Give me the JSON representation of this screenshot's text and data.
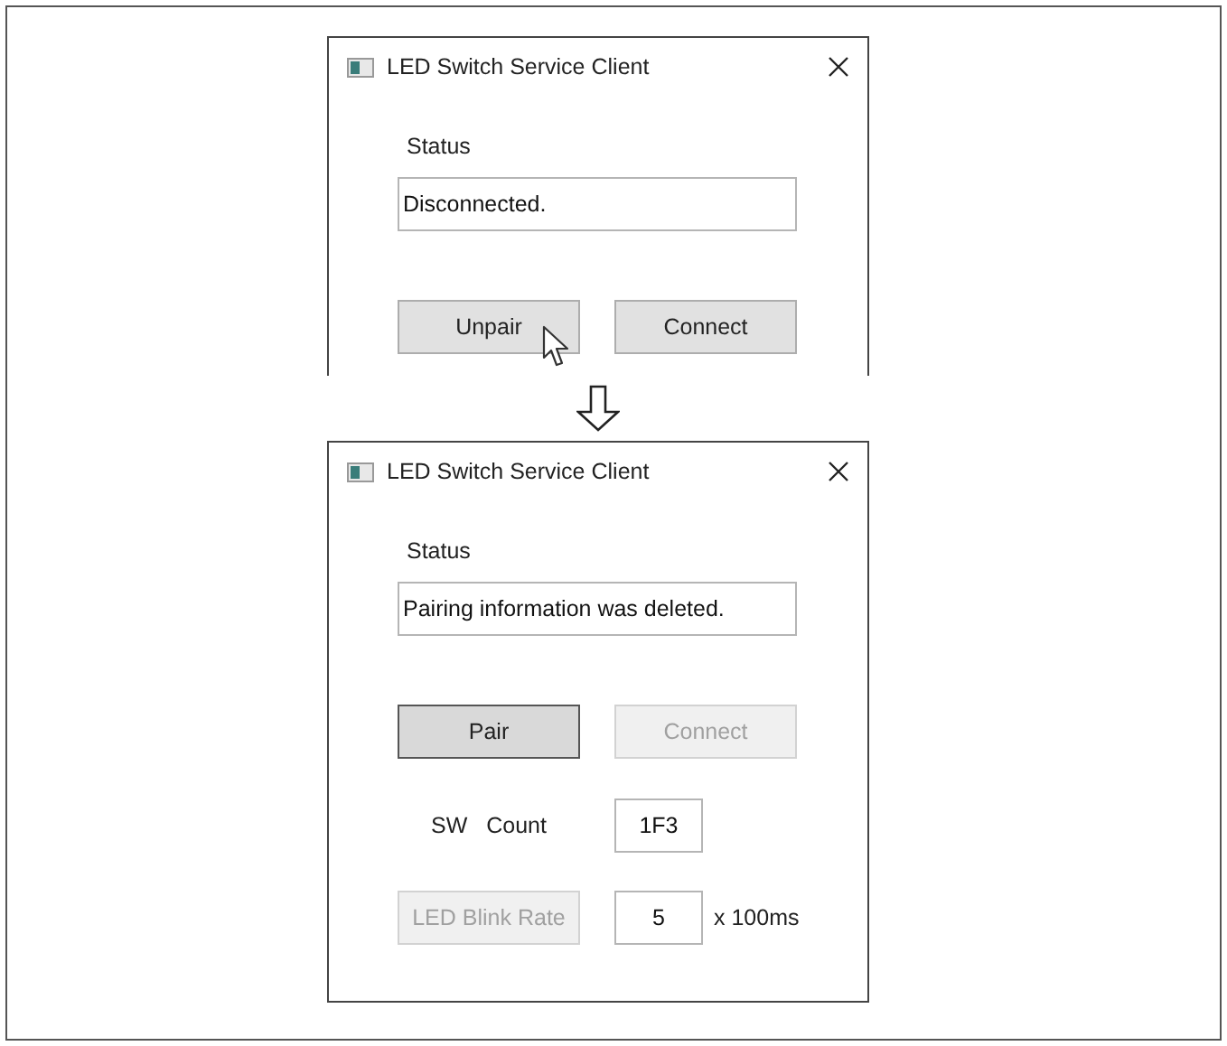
{
  "windows": [
    {
      "title": "LED Switch Service Client",
      "cropped": true,
      "status_label": "Status",
      "status_value": "Disconnected.",
      "buttons": [
        {
          "label": "Unpair",
          "disabled": false,
          "focused": false,
          "hovered": true
        },
        {
          "label": "Connect",
          "disabled": false,
          "focused": false,
          "hovered": false
        }
      ]
    },
    {
      "title": "LED Switch Service Client",
      "cropped": false,
      "status_label": "Status",
      "status_value": "Pairing information was deleted.",
      "buttons": [
        {
          "label": "Pair",
          "disabled": false,
          "focused": true,
          "hovered": false
        },
        {
          "label": "Connect",
          "disabled": true,
          "focused": false,
          "hovered": false
        }
      ],
      "sw_count": {
        "label": "SW   Count",
        "value": "1F3"
      },
      "blink_rate": {
        "button": {
          "label": "LED Blink Rate",
          "disabled": true
        },
        "value": "5",
        "unit": "x 100ms"
      }
    }
  ]
}
